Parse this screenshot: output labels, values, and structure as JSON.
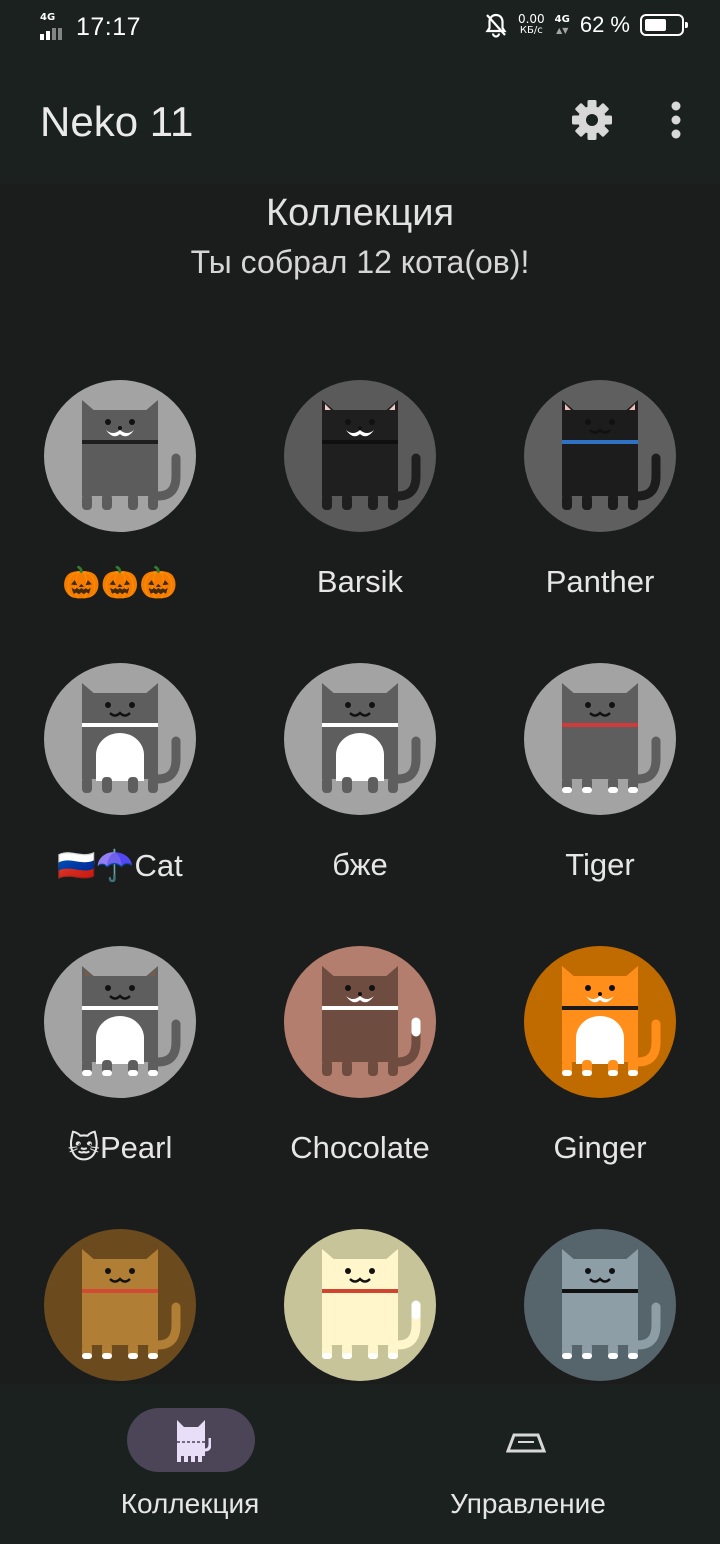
{
  "status_bar": {
    "network_tag": "4G",
    "time": "17:17",
    "data_rate_value": "0.00",
    "data_rate_unit": "КБ/с",
    "network_tag_2": "4G",
    "battery_percent_text": "62 %",
    "battery_level": 0.62,
    "icons": [
      "signal-icon",
      "bell-off-icon",
      "battery-icon"
    ]
  },
  "app_bar": {
    "title": "Neko 11",
    "icons": [
      "gear-icon",
      "more-vert-icon"
    ]
  },
  "header": {
    "title": "Коллекция",
    "subtitle": "Ты собрал 12 кота(ов)!"
  },
  "cats": [
    {
      "name": "🎃🎃🎃",
      "bg": "#a3a3a3",
      "body": "#5c5c5c",
      "collar": "#1e1e1e",
      "face": "mustache",
      "ears": "#5c5c5c",
      "belly": null,
      "paws": null,
      "tailtip": null
    },
    {
      "name": "Barsik",
      "bg": "#5a5a5a",
      "body": "#1f1f1f",
      "collar": "#0f0f0f",
      "face": "mustache",
      "ears": "#f1c7c7",
      "belly": null,
      "paws": null,
      "tailtip": null
    },
    {
      "name": "Panther",
      "bg": "#5f5f5f",
      "body": "#1c1c1c",
      "collar": "#2f72c4",
      "face": "smile",
      "ears": "#f0bcbc",
      "belly": null,
      "paws": null,
      "tailtip": null
    },
    {
      "name": "🇷🇺☂️Cat",
      "bg": "#a3a3a3",
      "body": "#5e5e5e",
      "collar": "#ffffff",
      "face": "smile",
      "ears": "#5e5e5e",
      "belly": "#ffffff",
      "paws": null,
      "tailtip": null
    },
    {
      "name": "бже",
      "bg": "#a3a3a3",
      "body": "#5e5e5e",
      "collar": "#ffffff",
      "face": "smile",
      "ears": "#5e5e5e",
      "belly": "#ffffff",
      "paws": null,
      "tailtip": null
    },
    {
      "name": "Tiger",
      "bg": "#a3a3a3",
      "body": "#5e5e5e",
      "collar": "#d03a3a",
      "face": "smile",
      "ears": "#5e5e5e",
      "belly": null,
      "paws": "#ffffff",
      "tailtip": null
    },
    {
      "name": "🐱Pearl",
      "bg": "#a3a3a3",
      "body": "#5e5e5e",
      "collar": "#ffffff",
      "face": "smile",
      "ears": "#7a5a4a",
      "belly": "#ffffff",
      "paws": "#ffffff",
      "tailtip": null
    },
    {
      "name": "Chocolate",
      "bg": "#b37e6d",
      "body": "#6f4c40",
      "collar": "#ffffff",
      "face": "mustache",
      "ears": "#6f4c40",
      "belly": null,
      "paws": null,
      "tailtip": "#ffffff"
    },
    {
      "name": "Ginger",
      "bg": "#c06b00",
      "body": "#ff8f1a",
      "collar": "#1a1a1a",
      "face": "mustache",
      "ears": "#ff8f1a",
      "belly": "#ffffff",
      "paws": "#ffffff",
      "tailtip": null
    },
    {
      "name": "",
      "bg": "#6b4a1d",
      "body": "#b17e35",
      "collar": "#d04a34",
      "face": "smile",
      "ears": "#b17e35",
      "belly": null,
      "paws": "#ffffff",
      "tailtip": null
    },
    {
      "name": "",
      "bg": "#c8c49a",
      "body": "#fff6cc",
      "collar": "#d0452f",
      "face": "smile",
      "ears": "#fff6cc",
      "belly": null,
      "paws": "#ffffff",
      "tailtip": "#ffffff"
    },
    {
      "name": "",
      "bg": "#56656b",
      "body": "#8e9ea6",
      "collar": "#111111",
      "face": "smile",
      "ears": "#8e9ea6",
      "belly": null,
      "paws": "#ffffff",
      "tailtip": null
    }
  ],
  "bottom_nav": {
    "items": [
      {
        "label": "Коллекция",
        "icon": "cat-icon",
        "active": true
      },
      {
        "label": "Управление",
        "icon": "controls-icon",
        "active": false
      }
    ],
    "active_pill_color": "#4b4557"
  }
}
